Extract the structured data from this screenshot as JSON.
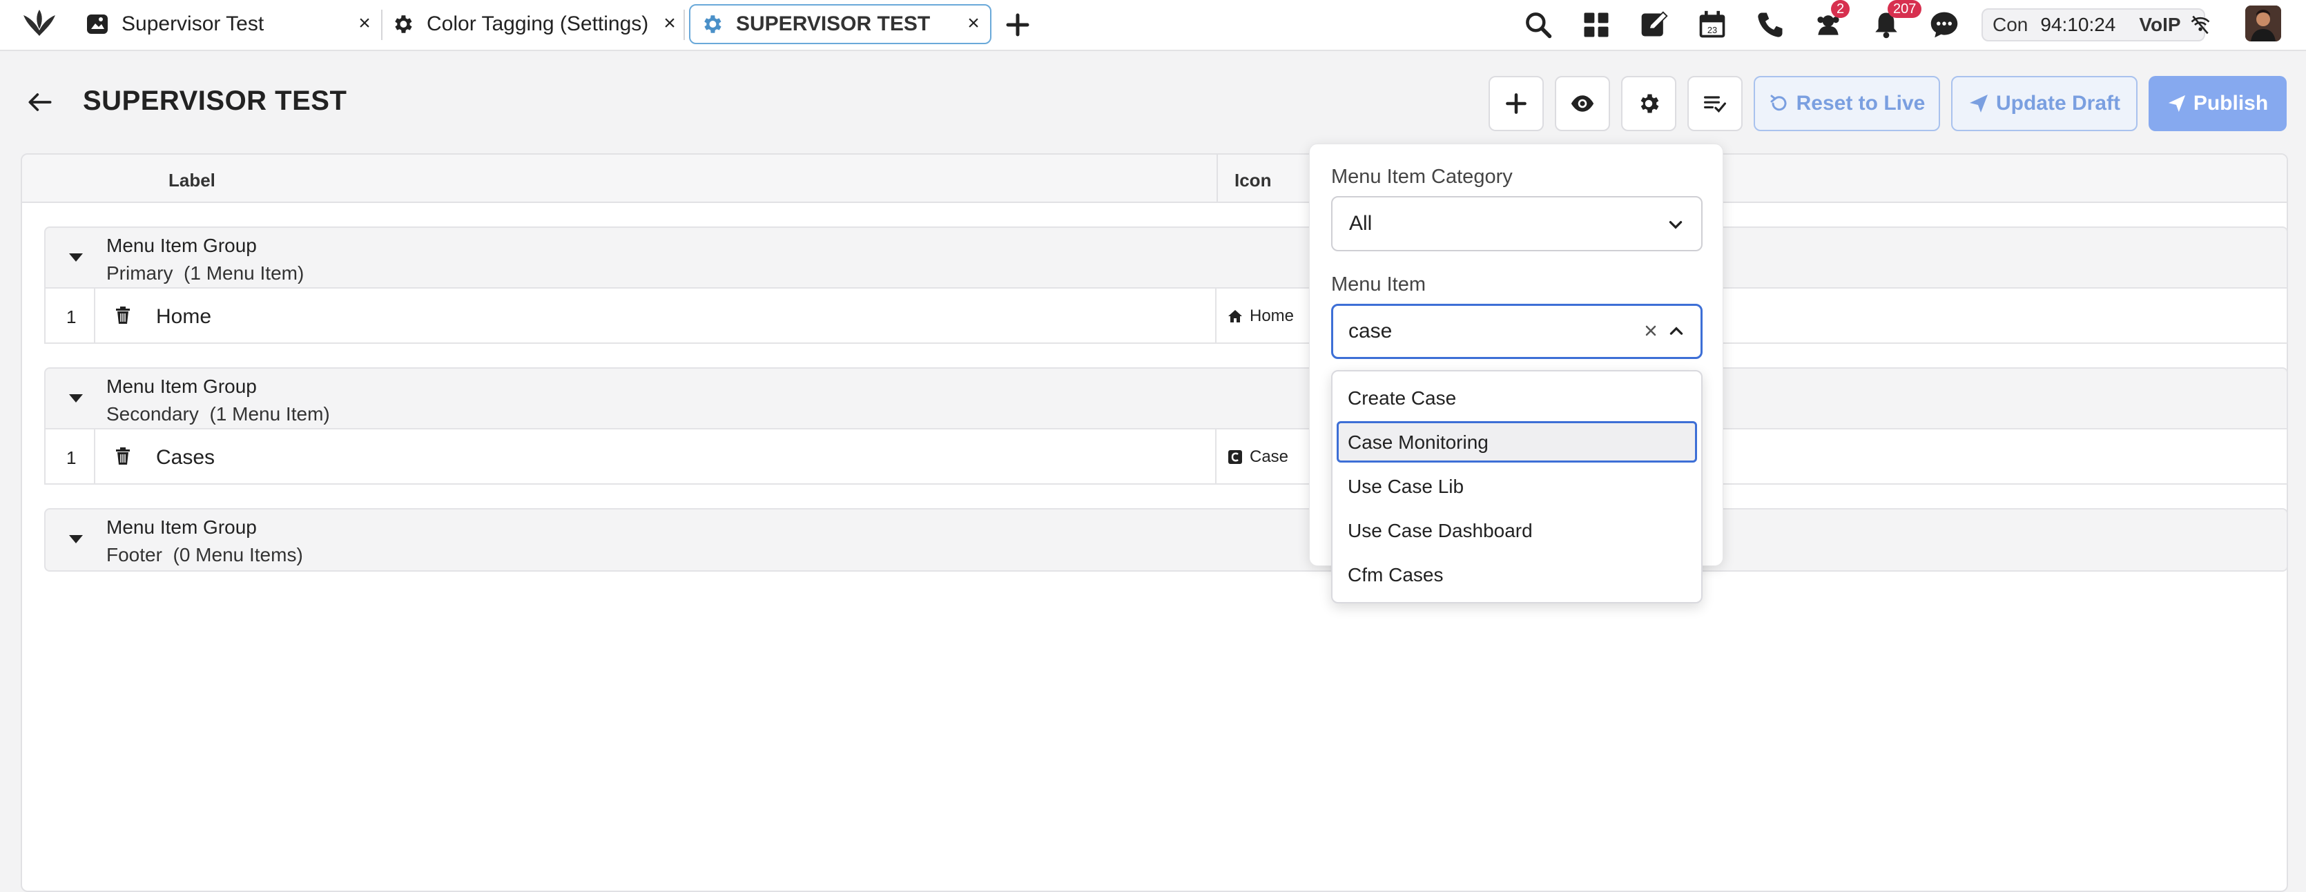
{
  "tabs": [
    {
      "label": "Supervisor Test",
      "icon": "image-tab-icon",
      "close": "×"
    },
    {
      "label": "Color Tagging (Settings)",
      "icon": "gear-icon",
      "close": "×"
    },
    {
      "label": "SUPERVISOR TEST",
      "icon": "gear-icon",
      "close": "×",
      "active": true
    }
  ],
  "toolbar": {
    "tasks_badge": "2",
    "notifications_badge": "207",
    "status_label": "Con",
    "timer": "94:10:24",
    "voip_label": "VoIP"
  },
  "header": {
    "title": "SUPERVISOR TEST",
    "reset_label": "Reset to Live",
    "update_label": "Update Draft",
    "publish_label": "Publish"
  },
  "table": {
    "col_label": "Label",
    "col_icon": "Icon",
    "groups": [
      {
        "title": "Menu Item Group",
        "name": "Primary",
        "count": "(1 Menu Item)",
        "rows": [
          {
            "num": "1",
            "label": "Home",
            "icon_name": "home-icon",
            "icon_text": "Home"
          }
        ]
      },
      {
        "title": "Menu Item Group",
        "name": "Secondary",
        "count": "(1 Menu Item)",
        "rows": [
          {
            "num": "1",
            "label": "Cases",
            "icon_name": "case-icon",
            "icon_text": "Case"
          }
        ]
      },
      {
        "title": "Menu Item Group",
        "name": "Footer",
        "count": "(0 Menu Items)",
        "rows": []
      }
    ]
  },
  "popover": {
    "category_label": "Menu Item Category",
    "category_value": "All",
    "item_label": "Menu Item",
    "item_value": "case",
    "options": [
      "Create Case",
      "Case Monitoring",
      "Use Case Lib",
      "Use Case Dashboard",
      "Cfm Cases"
    ],
    "highlighted_option": "Case Monitoring"
  },
  "colors": {
    "accent": "#3d6fd6",
    "publish": "#86a9ef",
    "badge": "#d7304f"
  }
}
